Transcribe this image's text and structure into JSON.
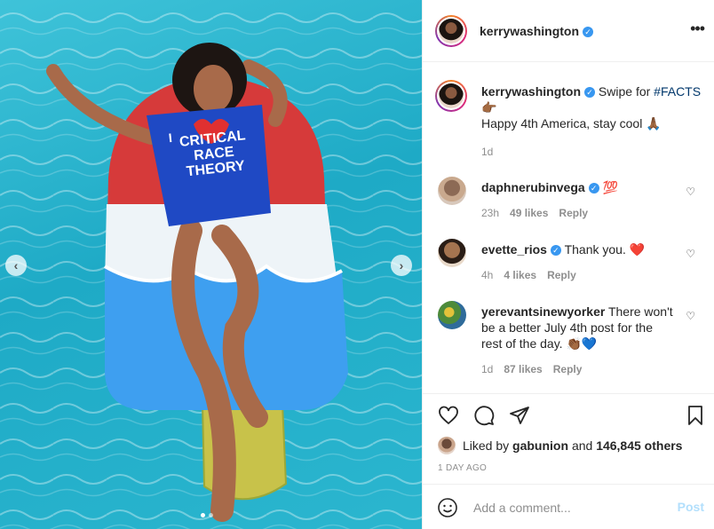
{
  "post": {
    "author": "kerrywashington",
    "verified": true
  },
  "media": {
    "shirt_lines": [
      "CRITICAL",
      "RACE",
      "THEORY"
    ],
    "shirt_prefix": "I",
    "slide_count": 2,
    "active_slide": 1
  },
  "caption": {
    "username": "kerrywashington",
    "text_before": "Swipe for",
    "hashtag": "#FACTS",
    "emoji_point": "👉🏾",
    "line2": "Happy 4th America, stay cool",
    "emoji_pray": "🙏🏾",
    "age": "1d"
  },
  "comments": [
    {
      "username": "daphnerubinvega",
      "verified": true,
      "text": "💯",
      "age": "23h",
      "likes": "49 likes",
      "reply": "Reply"
    },
    {
      "username": "evette_rios",
      "verified": true,
      "text": "Thank you. ❤️",
      "age": "4h",
      "likes": "4 likes",
      "reply": "Reply"
    },
    {
      "username": "yerevantsinewyorker",
      "verified": false,
      "text": "There won't be a better July 4th post for the rest of the day. 👏🏾💙",
      "age": "1d",
      "likes": "87 likes",
      "reply": "Reply"
    }
  ],
  "likes": {
    "prefix": "Liked by",
    "user": "gabunion",
    "joiner": "and",
    "others": "146,845 others"
  },
  "timestamp": "1 DAY AGO",
  "add_comment": {
    "placeholder": "Add a comment...",
    "post_label": "Post"
  },
  "colors": {
    "pool": "#2bb6cf",
    "shirt": "#1f49c4",
    "verified": "#3897f0",
    "hashtag": "#00376b",
    "post_disabled": "#b2dffc"
  }
}
